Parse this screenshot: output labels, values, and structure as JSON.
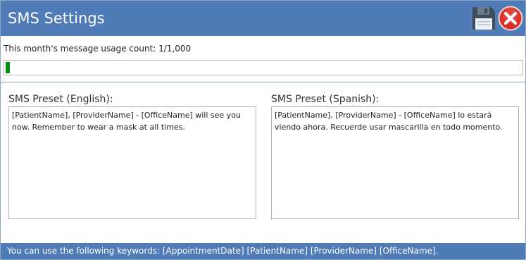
{
  "window": {
    "title": "SMS Settings"
  },
  "toolbar": {
    "save_icon": "floppy-disk-icon",
    "close_icon": "close-x-icon",
    "close_color": "#d9312b"
  },
  "usage": {
    "label": "This month's message usage count: 1/1,000",
    "used": 1,
    "limit": 1000,
    "fill_color": "#0b8a0b"
  },
  "presets": {
    "english": {
      "label": "SMS Preset (English):",
      "value": "[PatientName], [ProviderName] - [OfficeName] will see you now. Remember to wear a mask at all times."
    },
    "spanish": {
      "label": "SMS Preset (Spanish):",
      "value": "[PatientName], [ProviderName] - [OfficeName] lo estará viendo ahora. Recuerde usar mascarilla en todo momento."
    }
  },
  "footer": {
    "text": "You can use the following keywords: [AppointmentDate] [PatientName] [ProviderName] [OfficeName]."
  },
  "colors": {
    "header": "#4f7bb6",
    "footer": "#4f7bb6"
  }
}
